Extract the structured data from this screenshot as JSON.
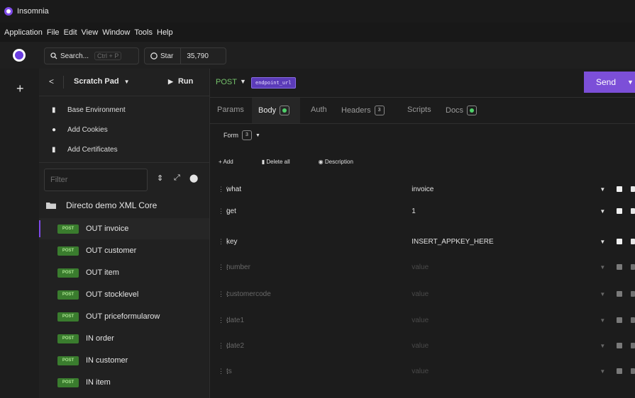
{
  "window": {
    "title": "Insomnia"
  },
  "menu": [
    "Application",
    "File",
    "Edit",
    "View",
    "Window",
    "Tools",
    "Help"
  ],
  "toolbar": {
    "search_label": "Search...",
    "search_shortcut": "Ctrl + P",
    "star_label": "Star",
    "star_count": "35,790"
  },
  "sidebar": {
    "collection_name": "Scratch Pad",
    "run_label": "Run",
    "links": [
      "Base Environment",
      "Add Cookies",
      "Add Certificates"
    ],
    "filter_placeholder": "Filter",
    "folder": "Directo demo XML Core",
    "requests": [
      {
        "method": "POST",
        "name": "OUT invoice",
        "active": true
      },
      {
        "method": "POST",
        "name": "OUT customer"
      },
      {
        "method": "POST",
        "name": "OUT item"
      },
      {
        "method": "POST",
        "name": "OUT stocklevel"
      },
      {
        "method": "POST",
        "name": "OUT priceformularow"
      },
      {
        "method": "POST",
        "name": "IN order"
      },
      {
        "method": "POST",
        "name": "IN customer"
      },
      {
        "method": "POST",
        "name": "IN item"
      }
    ]
  },
  "request": {
    "method": "POST",
    "url": "endpoint_url",
    "send_label": "Send",
    "tabs": {
      "params": "Params",
      "body": "Body",
      "auth": "Auth",
      "headers": "Headers",
      "headers_count": "3",
      "scripts": "Scripts",
      "docs": "Docs"
    },
    "body_type": "Form",
    "body_count": "3",
    "actions": {
      "add": "Add",
      "delete_all": "Delete all",
      "description": "Description"
    },
    "params": [
      {
        "key": "what",
        "value": "invoice",
        "enabled": true
      },
      {
        "key": "get",
        "value": "1",
        "enabled": true
      },
      {
        "key": "key",
        "value": "INSERT_APPKEY_HERE",
        "enabled": true
      },
      {
        "key": "number",
        "value": "value",
        "enabled": false
      },
      {
        "key": "customercode",
        "value": "value",
        "enabled": false
      },
      {
        "key": "date1",
        "value": "value",
        "enabled": false
      },
      {
        "key": "date2",
        "value": "value",
        "enabled": false
      },
      {
        "key": "ts",
        "value": "value",
        "enabled": false
      }
    ]
  }
}
